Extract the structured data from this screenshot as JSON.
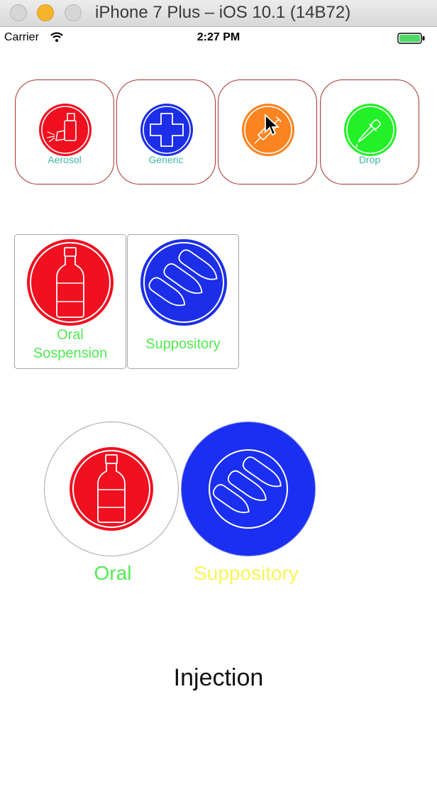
{
  "window": {
    "title": "iPhone 7 Plus – iOS 10.1 (14B72)"
  },
  "status_bar": {
    "carrier": "Carrier",
    "time": "2:27 PM"
  },
  "row1": [
    {
      "label": "Aerosol",
      "icon": "aerosol-icon",
      "color": "#f01020"
    },
    {
      "label": "Generic",
      "icon": "cross-icon",
      "color": "#1c2ee8"
    },
    {
      "label": "",
      "icon": "syringe-icon",
      "color": "#f98420"
    },
    {
      "label": "Drop",
      "icon": "dropper-icon",
      "color": "#22f028"
    }
  ],
  "row2": [
    {
      "label_line1": "Oral",
      "label_line2": "Sospension",
      "icon": "bottle-icon",
      "color": "#f01020"
    },
    {
      "label": "Suppository",
      "icon": "suppository-icon",
      "color": "#1c2ee8"
    }
  ],
  "row3": [
    {
      "label": "Oral",
      "icon": "bottle-icon",
      "color": "#f01020",
      "label_color": "#52ea52"
    },
    {
      "label": "Suppository",
      "icon": "suppository-icon",
      "color": "#1a2ff2",
      "label_color": "#f7f55a"
    }
  ],
  "injection_label": "Injection"
}
